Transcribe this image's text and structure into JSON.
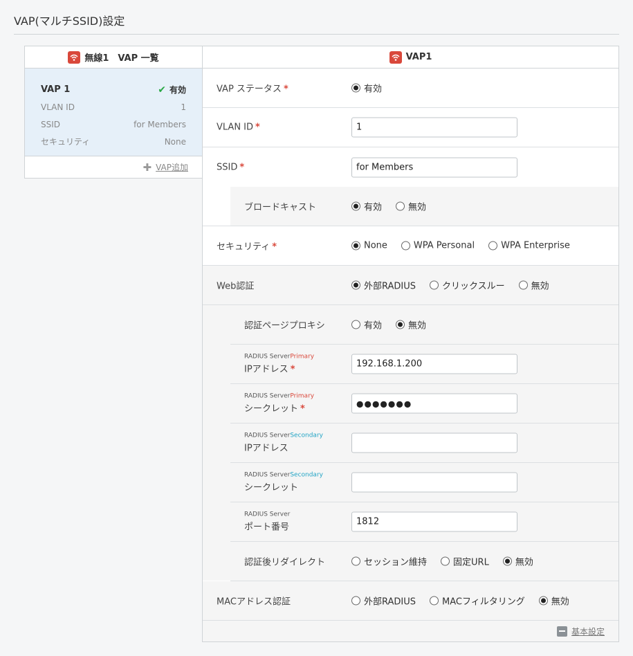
{
  "page": {
    "title": "VAP(マルチSSID)設定"
  },
  "vap_list": {
    "header": "無線1　VAP 一覧",
    "card": {
      "name": "VAP 1",
      "status": "有効",
      "rows": [
        {
          "label": "VLAN ID",
          "value": "1"
        },
        {
          "label": "SSID",
          "value": "for Members"
        },
        {
          "label": "セキュリティ",
          "value": "None"
        }
      ]
    },
    "add_label": "VAP追加"
  },
  "form": {
    "header": "VAP1",
    "vap_status": {
      "label": "VAP ステータス",
      "option": "有効"
    },
    "vlan_id": {
      "label": "VLAN ID",
      "value": "1"
    },
    "ssid": {
      "label": "SSID",
      "value": "for Members"
    },
    "broadcast": {
      "label": "ブロードキャスト",
      "options": [
        "有効",
        "無効"
      ]
    },
    "security": {
      "label": "セキュリティ",
      "options": [
        "None",
        "WPA Personal",
        "WPA Enterprise"
      ]
    },
    "web_auth": {
      "label": "Web認証",
      "options": [
        "外部RADIUS",
        "クリックスルー",
        "無効"
      ]
    },
    "auth_proxy": {
      "label": "認証ページプロキシ",
      "options": [
        "有効",
        "無効"
      ]
    },
    "radius_primary_ip": {
      "small": "RADIUS Server",
      "tag": "Primary",
      "label": "IPアドレス",
      "value": "192.168.1.200"
    },
    "radius_primary_secret": {
      "small": "RADIUS Server",
      "tag": "Primary",
      "label": "シークレット",
      "value": "●●●●●●●"
    },
    "radius_secondary_ip": {
      "small": "RADIUS Server",
      "tag": "Secondary",
      "label": "IPアドレス",
      "value": ""
    },
    "radius_secondary_secret": {
      "small": "RADIUS Server",
      "tag": "Secondary",
      "label": "シークレット",
      "value": ""
    },
    "radius_port": {
      "small": "RADIUS Server",
      "label": "ポート番号",
      "value": "1812"
    },
    "redirect": {
      "label": "認証後リダイレクト",
      "options": [
        "セッション維持",
        "固定URL",
        "無効"
      ]
    },
    "mac_auth": {
      "label": "MACアドレス認証",
      "options": [
        "外部RADIUS",
        "MACフィルタリング",
        "無効"
      ]
    },
    "basic_settings_label": "基本設定"
  },
  "selected": {
    "vap_status": "有効",
    "broadcast": "有効",
    "security": "None",
    "web_auth": "外部RADIUS",
    "auth_proxy": "無効",
    "redirect": "無効",
    "mac_auth": "無効"
  },
  "colors": {
    "accent_red": "#d9483b",
    "secondary_tag": "#20a3c4",
    "check_green": "#2aa845",
    "card_bg": "#e6f0f9"
  },
  "icons": [
    "wifi-icon",
    "check-icon",
    "plus-icon",
    "minus-icon"
  ]
}
